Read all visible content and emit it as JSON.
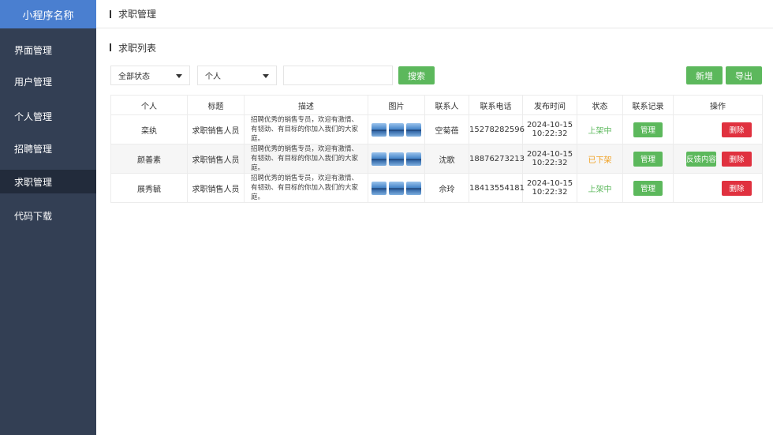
{
  "app_name": "小程序名称",
  "sidebar": {
    "items": [
      {
        "label": "界面管理"
      },
      {
        "label": "用户管理"
      },
      {
        "label": "个人管理"
      },
      {
        "label": "招聘管理"
      },
      {
        "label": "求职管理",
        "active": true
      },
      {
        "label": "代码下载"
      }
    ]
  },
  "header": {
    "title": "求职管理"
  },
  "section": {
    "title": "求职列表"
  },
  "filters": {
    "status_select": "全部状态",
    "person_select": "个人",
    "search_placeholder": "",
    "search_label": "搜索",
    "add_label": "新增",
    "export_label": "导出"
  },
  "table": {
    "columns": [
      "个人",
      "标题",
      "描述",
      "图片",
      "联系人",
      "联系电话",
      "发布时间",
      "状态",
      "联系记录",
      "操作"
    ],
    "rows": [
      {
        "person": "栾纨",
        "title": "求职销售人员",
        "desc": "招聘优秀的销售专员，欢迎有激情、有韧劲、有目标的你加入我们的大家庭。",
        "contact": "空菊蓓",
        "phone": "15278282596",
        "date": "2024-10-15",
        "time": "10:22:32",
        "status": "上架中",
        "record_btn": "管理",
        "feedback_btn": "",
        "delete_btn": "删除"
      },
      {
        "person": "颜善素",
        "title": "求职销售人员",
        "desc": "招聘优秀的销售专员，欢迎有激情、有韧劲、有目标的你加入我们的大家庭。",
        "contact": "沈歌",
        "phone": "18876273213",
        "date": "2024-10-15",
        "time": "10:22:32",
        "status": "已下架",
        "record_btn": "管理",
        "feedback_btn": "反馈内容",
        "delete_btn": "删除"
      },
      {
        "person": "展秀毓",
        "title": "求职销售人员",
        "desc": "招聘优秀的销售专员，欢迎有激情、有韧劲、有目标的你加入我们的大家庭。",
        "contact": "佘玲",
        "phone": "18413554181",
        "date": "2024-10-15",
        "time": "10:22:32",
        "status": "上架中",
        "record_btn": "管理",
        "feedback_btn": "",
        "delete_btn": "删除"
      }
    ]
  },
  "colors": {
    "sidebar": "#333f54",
    "logo": "#4a7fd0",
    "green": "#5cb85c",
    "red": "#e0313f",
    "orange": "#f0a020"
  }
}
